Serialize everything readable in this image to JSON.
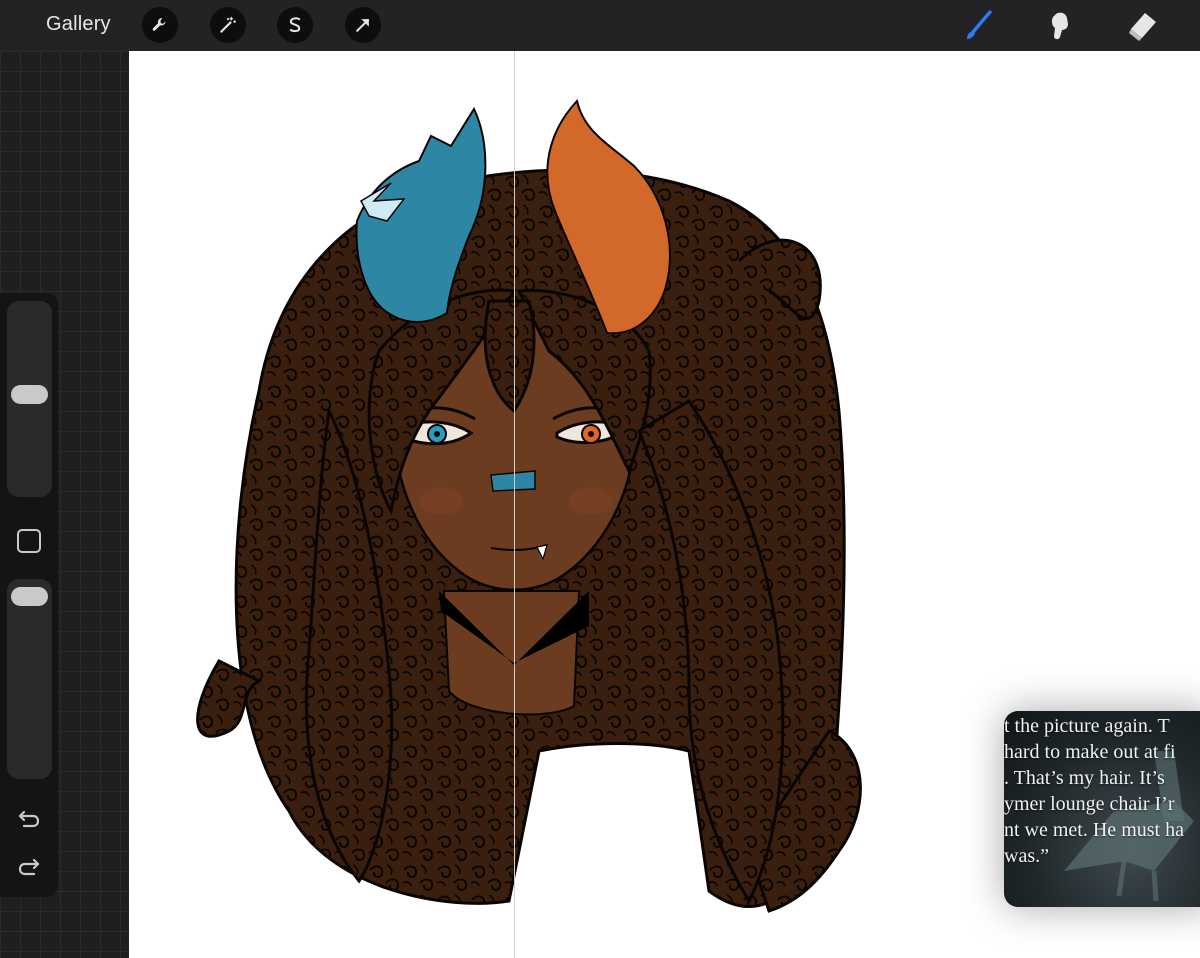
{
  "toolbar": {
    "gallery_label": "Gallery",
    "left_tools": [
      "wrench-icon",
      "magic-wand-icon",
      "selection-icon",
      "transform-arrow-icon"
    ],
    "right_tools": [
      "brush-icon",
      "smudge-icon",
      "eraser-icon"
    ],
    "active_tool": "brush-icon",
    "accent_color": "#2f7bf6"
  },
  "sidebar": {
    "brush_size_level": 0.3,
    "opacity_level": 0.05,
    "controls": [
      "brush-size-slider",
      "modify-button",
      "opacity-slider",
      "undo-icon",
      "redo-icon"
    ]
  },
  "canvas": {
    "background": "#ffffff",
    "colors": {
      "hair": "#3a1f0e",
      "skin": "#6b3c1f",
      "left_horn": "#2e86a5",
      "left_horn_highlight": "#cfeaf5",
      "right_horn": "#d2692a",
      "left_eye": "#2a9bc2",
      "right_eye": "#e2652a"
    }
  },
  "pip": {
    "lines": [
      "t the picture again. T",
      "hard to make out at fi",
      ". That’s my hair. It’s",
      "ymer lounge chair I’r",
      "nt we met. He must ha",
      " was.”"
    ]
  }
}
